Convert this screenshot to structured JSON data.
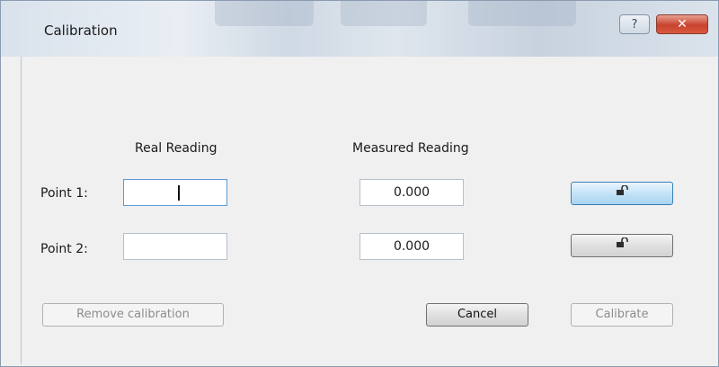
{
  "window": {
    "title": "Calibration",
    "help_label": "?",
    "close_label": "✕"
  },
  "columns": {
    "real": "Real Reading",
    "measured": "Measured Reading"
  },
  "rows": [
    {
      "label": "Point 1:",
      "real_value": "",
      "measured_value": "0.000",
      "lock_icon": "unlock-icon"
    },
    {
      "label": "Point 2:",
      "real_value": "",
      "measured_value": "0.000",
      "lock_icon": "unlock-icon"
    }
  ],
  "buttons": {
    "remove_calibration": "Remove calibration",
    "cancel": "Cancel",
    "calibrate": "Calibrate"
  }
}
